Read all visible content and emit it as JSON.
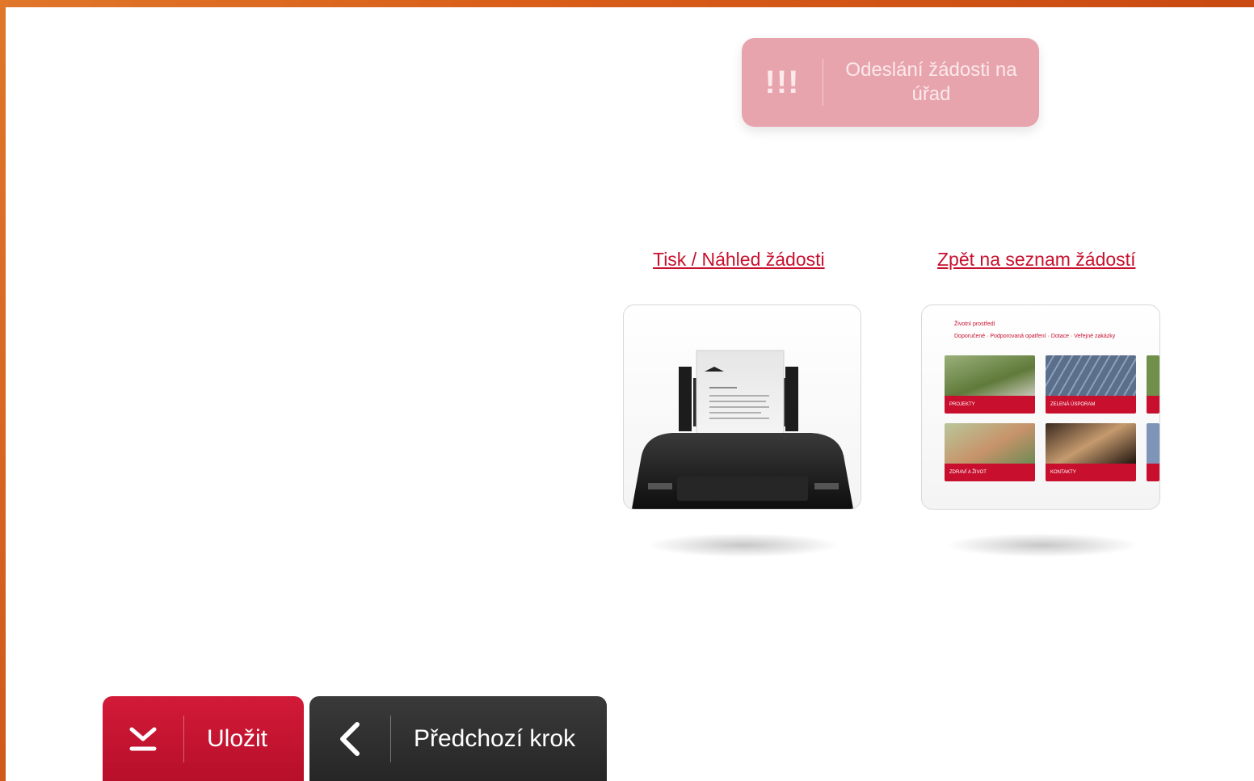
{
  "send_button": {
    "mark": "!!!",
    "label": "Odeslání žádosti na úřad"
  },
  "links": {
    "print": "Tisk / Náhled žádosti",
    "back_to_list": "Zpět na seznam žádostí"
  },
  "thumbnail": {
    "title": "Životní prostředí",
    "nav": "Doporučené · Podporovaná opatření · Dotace · Veřejné zakázky",
    "tiles": [
      "PROJEKTY",
      "ZELENÁ ÚSPORAM",
      "ZDRAVÍ A ŽIVOT",
      "KONTAKTY"
    ]
  },
  "bottom_buttons": {
    "save_label": "Uložit",
    "previous_label": "Předchozí krok"
  },
  "colors": {
    "accent_red": "#c8102e",
    "disabled_pink": "#e8a4ad",
    "dark_button": "#2e2e2e",
    "frame_orange": "#d95f1a"
  }
}
